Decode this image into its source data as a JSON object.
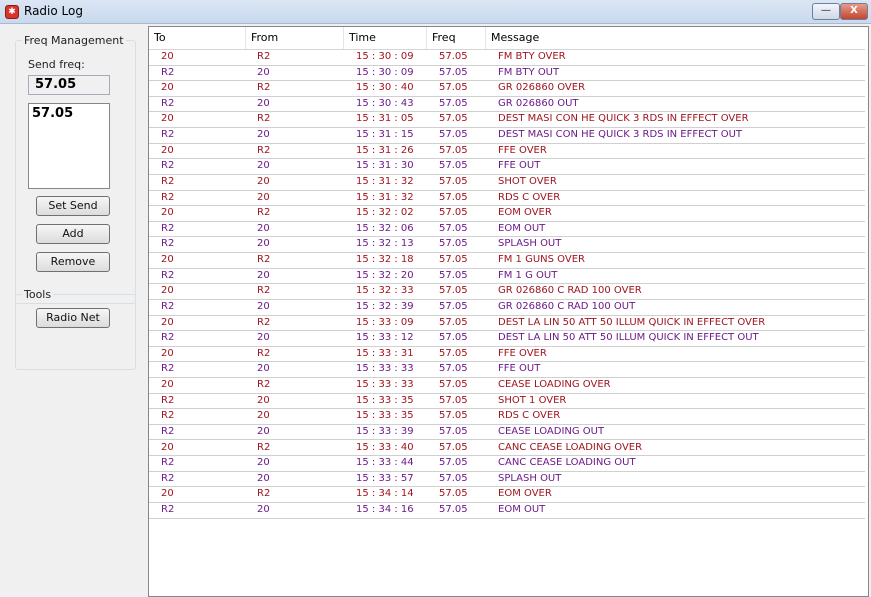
{
  "window": {
    "title": "Radio Log",
    "minimize_glyph": "—",
    "close_glyph": "X"
  },
  "freq_management": {
    "group_label": "Freq Management",
    "send_freq_label": "Send freq:",
    "send_freq_value": "57.05",
    "freq_list": [
      "57.05"
    ],
    "buttons": {
      "set_send": "Set Send",
      "add": "Add",
      "remove": "Remove"
    }
  },
  "tools": {
    "group_label": "Tools",
    "radio_net_button": "Radio Net"
  },
  "log": {
    "columns": [
      "To",
      "From",
      "Time",
      "Freq",
      "Message"
    ],
    "rows": [
      {
        "to": "20",
        "from": "R2",
        "time": "15 : 30 : 09",
        "freq": "57.05",
        "msg": "FM BTY OVER"
      },
      {
        "to": "R2",
        "from": "20",
        "time": "15 : 30 : 09",
        "freq": "57.05",
        "msg": "FM BTY OUT"
      },
      {
        "to": "20",
        "from": "R2",
        "time": "15 : 30 : 40",
        "freq": "57.05",
        "msg": "GR 026860 OVER"
      },
      {
        "to": "R2",
        "from": "20",
        "time": "15 : 30 : 43",
        "freq": "57.05",
        "msg": "GR 026860 OUT"
      },
      {
        "to": "20",
        "from": "R2",
        "time": "15 : 31 : 05",
        "freq": "57.05",
        "msg": "DEST MASI CON HE QUICK 3 RDS IN EFFECT OVER"
      },
      {
        "to": "R2",
        "from": "20",
        "time": "15 : 31 : 15",
        "freq": "57.05",
        "msg": "DEST MASI CON HE QUICK 3 RDS IN EFFECT OUT"
      },
      {
        "to": "20",
        "from": "R2",
        "time": "15 : 31 : 26",
        "freq": "57.05",
        "msg": "FFE OVER"
      },
      {
        "to": "R2",
        "from": "20",
        "time": "15 : 31 : 30",
        "freq": "57.05",
        "msg": "FFE OUT"
      },
      {
        "to": "R2",
        "from": "20",
        "time": "15 : 31 : 32",
        "freq": "57.05",
        "msg": "SHOT OVER"
      },
      {
        "to": "R2",
        "from": "20",
        "time": "15 : 31 : 32",
        "freq": "57.05",
        "msg": "RDS C OVER"
      },
      {
        "to": "20",
        "from": "R2",
        "time": "15 : 32 : 02",
        "freq": "57.05",
        "msg": "EOM OVER"
      },
      {
        "to": "R2",
        "from": "20",
        "time": "15 : 32 : 06",
        "freq": "57.05",
        "msg": "EOM OUT"
      },
      {
        "to": "R2",
        "from": "20",
        "time": "15 : 32 : 13",
        "freq": "57.05",
        "msg": "SPLASH OUT"
      },
      {
        "to": "20",
        "from": "R2",
        "time": "15 : 32 : 18",
        "freq": "57.05",
        "msg": "FM 1 GUNS OVER"
      },
      {
        "to": "R2",
        "from": "20",
        "time": "15 : 32 : 20",
        "freq": "57.05",
        "msg": "FM 1 G OUT"
      },
      {
        "to": "20",
        "from": "R2",
        "time": "15 : 32 : 33",
        "freq": "57.05",
        "msg": "GR 026860 C RAD 100 OVER"
      },
      {
        "to": "R2",
        "from": "20",
        "time": "15 : 32 : 39",
        "freq": "57.05",
        "msg": "GR 026860 C RAD 100 OUT"
      },
      {
        "to": "20",
        "from": "R2",
        "time": "15 : 33 : 09",
        "freq": "57.05",
        "msg": "DEST LA LIN 50 ATT 50 ILLUM QUICK IN EFFECT OVER"
      },
      {
        "to": "R2",
        "from": "20",
        "time": "15 : 33 : 12",
        "freq": "57.05",
        "msg": "DEST LA LIN 50 ATT 50 ILLUM QUICK IN EFFECT OUT"
      },
      {
        "to": "20",
        "from": "R2",
        "time": "15 : 33 : 31",
        "freq": "57.05",
        "msg": "FFE OVER"
      },
      {
        "to": "R2",
        "from": "20",
        "time": "15 : 33 : 33",
        "freq": "57.05",
        "msg": "FFE OUT"
      },
      {
        "to": "20",
        "from": "R2",
        "time": "15 : 33 : 33",
        "freq": "57.05",
        "msg": "CEASE LOADING OVER"
      },
      {
        "to": "R2",
        "from": "20",
        "time": "15 : 33 : 35",
        "freq": "57.05",
        "msg": "SHOT 1 OVER"
      },
      {
        "to": "R2",
        "from": "20",
        "time": "15 : 33 : 35",
        "freq": "57.05",
        "msg": "RDS C OVER"
      },
      {
        "to": "R2",
        "from": "20",
        "time": "15 : 33 : 39",
        "freq": "57.05",
        "msg": "CEASE LOADING OUT"
      },
      {
        "to": "20",
        "from": "R2",
        "time": "15 : 33 : 40",
        "freq": "57.05",
        "msg": "CANC CEASE LOADING OVER"
      },
      {
        "to": "R2",
        "from": "20",
        "time": "15 : 33 : 44",
        "freq": "57.05",
        "msg": "CANC CEASE LOADING OUT"
      },
      {
        "to": "R2",
        "from": "20",
        "time": "15 : 33 : 57",
        "freq": "57.05",
        "msg": "SPLASH OUT"
      },
      {
        "to": "20",
        "from": "R2",
        "time": "15 : 34 : 14",
        "freq": "57.05",
        "msg": "EOM OVER"
      },
      {
        "to": "R2",
        "from": "20",
        "time": "15 : 34 : 16",
        "freq": "57.05",
        "msg": "EOM OUT"
      }
    ]
  },
  "colors": {
    "over_text": "#a0141e",
    "out_text": "#6c1a8a"
  }
}
